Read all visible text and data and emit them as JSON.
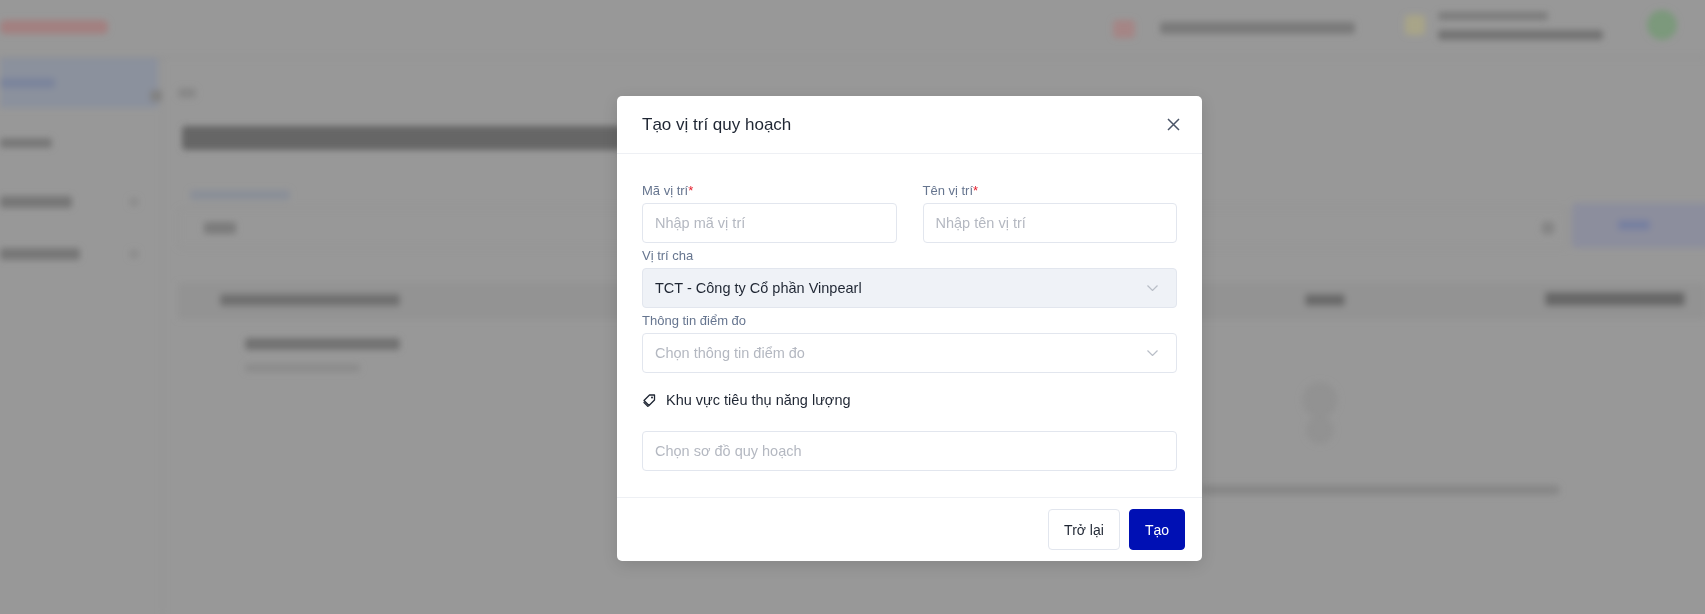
{
  "dialog": {
    "title": "Tạo vị trí quy hoạch",
    "rows": [
      {
        "fields": [
          {
            "kind": "text",
            "label": "Mã vị trí",
            "required_mark": "*",
            "placeholder": "Nhập mã vị trí",
            "disabled": false
          },
          {
            "kind": "text",
            "label": "Tên vị trí",
            "required_mark": "*",
            "placeholder": "Nhập tên vị trí",
            "disabled": false
          }
        ]
      },
      {
        "fields": [
          {
            "kind": "select",
            "label": "Vị trí cha",
            "value": "TCT - Công ty Cổ phần Vinpearl",
            "disabled": true
          }
        ]
      },
      {
        "fields": [
          {
            "kind": "select",
            "label": "Thông tin điểm đo",
            "placeholder": "Chọn thông tin điểm đo",
            "disabled": false
          }
        ]
      }
    ],
    "section": {
      "label": "Khu vực tiêu thụ năng lượng",
      "field": {
        "kind": "text",
        "placeholder": "Chọn sơ đồ quy hoạch",
        "disabled": false
      }
    },
    "buttons": [
      {
        "kind": "secondary",
        "label": "Trở lại"
      },
      {
        "kind": "primary",
        "label": "Tạo"
      }
    ]
  }
}
